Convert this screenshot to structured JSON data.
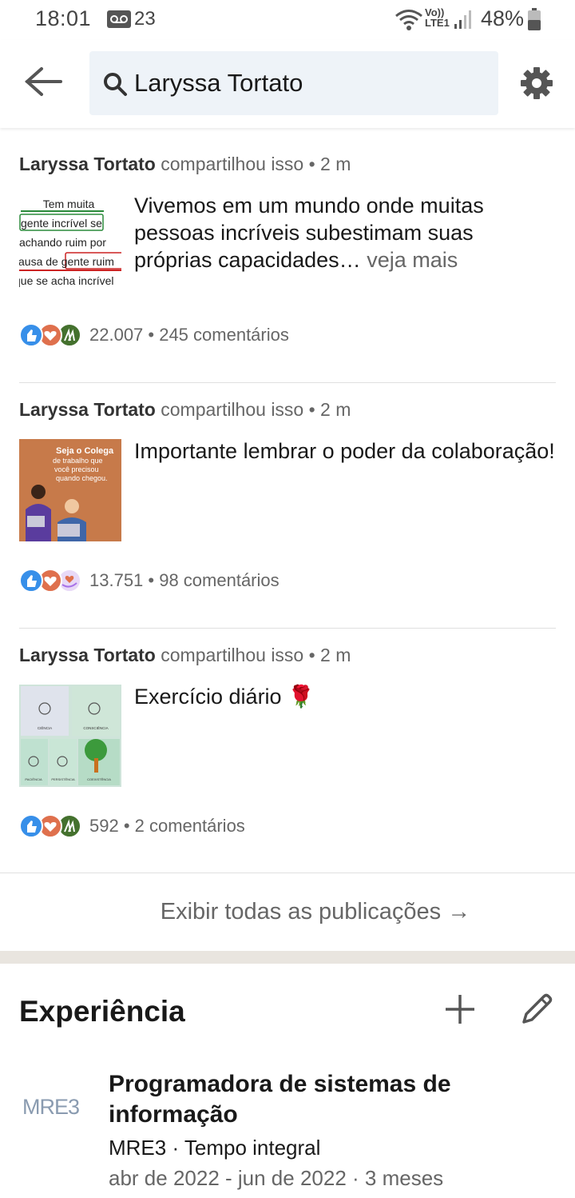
{
  "status_bar": {
    "time": "18:01",
    "notification": "23",
    "network": "Vo)) LTE1",
    "battery": "48%"
  },
  "header": {
    "search_value": "Laryssa Tortato"
  },
  "posts": [
    {
      "author": "Laryssa Tortato",
      "action": "compartilhou isso • 2 m",
      "text": "Vivemos em um mundo onde muitas pessoas incríveis subestimam suas próprias capacidades…",
      "see_more": "veja mais",
      "thumb_lines": [
        "Tem muita",
        "gente incrível se",
        "achando ruim por",
        "causa de gente ruim",
        "que se acha incrível"
      ],
      "reactions": "22.007 • 245 comentários",
      "reaction_icons": [
        "like-icon",
        "love-icon",
        "celebrate-icon"
      ]
    },
    {
      "author": "Laryssa Tortato",
      "action": "compartilhou isso • 2 m",
      "text": "Importante lembrar o poder da colaboração!",
      "see_more": "",
      "thumb_lines": [
        "Seja o Colega",
        "de trabalho que",
        "você precisou",
        "quando chegou."
      ],
      "reactions": "13.751 • 98 comentários",
      "reaction_icons": [
        "like-icon",
        "love-icon",
        "support-icon"
      ]
    },
    {
      "author": "Laryssa Tortato",
      "action": "compartilhou isso • 2 m",
      "text": "Exercício diário 🌹",
      "see_more": "",
      "thumb_lines": [
        "CIÊNCIA",
        "CONSCIÊNCIA",
        "PACIÊNCIA",
        "PERSISTÊNCIA",
        "COEXISTÊNCIA"
      ],
      "reactions": "592 • 2 comentários",
      "reaction_icons": [
        "like-icon",
        "love-icon",
        "celebrate-icon"
      ]
    }
  ],
  "see_all": "Exibir todas as publicações →",
  "experience": {
    "title": "Experiência",
    "items": [
      {
        "logo": "MRE3",
        "role": "Programadora de sistemas de informação",
        "company": "MRE3 · Tempo integral",
        "dates": "abr de 2022 - jun de 2022 · 3 meses"
      }
    ]
  },
  "colors": {
    "like": "#378fe9",
    "love": "#df704d",
    "celebrate": "#44712e",
    "support": "#a872e8",
    "search_bg": "#eef3f8",
    "section_gap": "#e9e5df"
  }
}
